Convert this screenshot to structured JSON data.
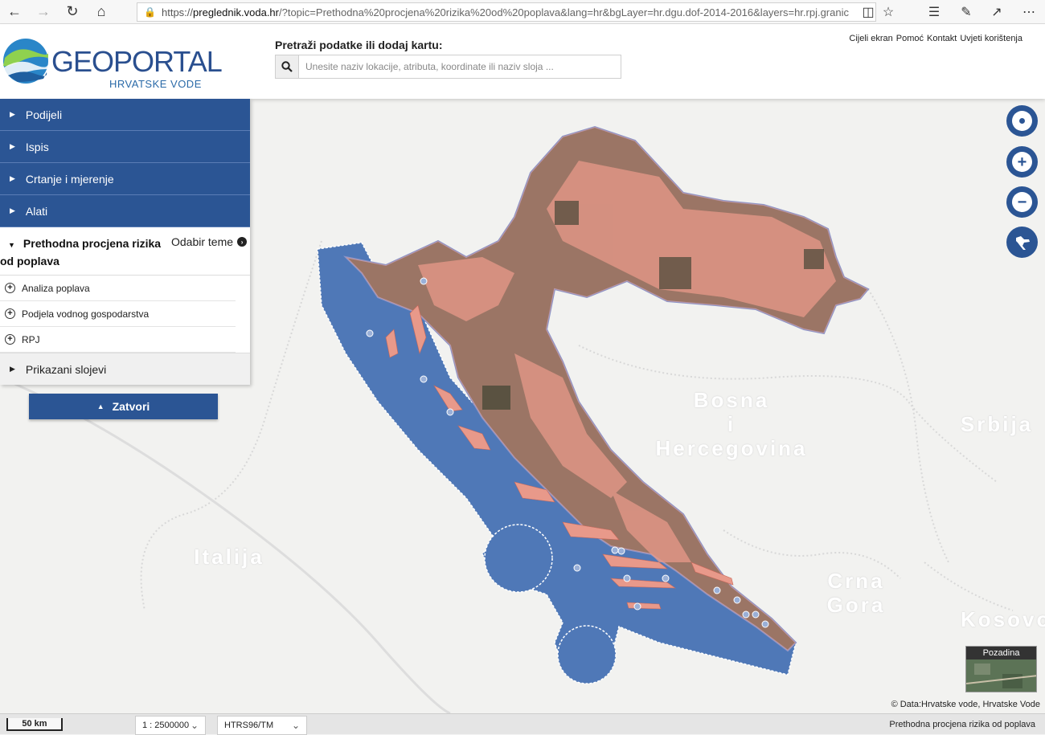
{
  "browser": {
    "url_prefix": "https://",
    "url_domain": "preglednik.voda.hr",
    "url_rest": "/?topic=Prethodna%20procjena%20rizika%20od%20poplava&lang=hr&bgLayer=hr.dgu.dof-2014-2016&layers=hr.rpj.granic"
  },
  "header": {
    "logo_word": "GEOPORTAL",
    "logo_sub": "HRVATSKE VODE",
    "search_label": "Pretraži podatke ili dodaj kartu:",
    "search_placeholder": "Unesite naziv lokacije, atributa, koordinate ili naziv sloja ...",
    "links": [
      "Cijeli ekran",
      "Pomoć",
      "Kontakt",
      "Uvjeti korištenja"
    ]
  },
  "panel": {
    "menu": [
      "Podijeli",
      "Ispis",
      "Crtanje i mjerenje",
      "Alati"
    ],
    "topic_title": "Prethodna procjena rizika od poplava",
    "topic_link": "Odabir teme",
    "layers": [
      "Analiza poplava",
      "Podjela vodnog gospodarstva",
      "RPJ"
    ],
    "shown_layers": "Prikazani slojevi",
    "close_label": "Zatvori"
  },
  "map": {
    "labels": {
      "bosna": "Bosna\ni\nHercegovina",
      "srbija": "Srbija",
      "italija": "Italija",
      "crna_gora": "Crna\nGora",
      "kosovo": "Kosovo"
    },
    "background_label": "Pozadina",
    "attribution_prefix": "© Data:",
    "attribution_links": "Hrvatske vode, Hrvatske Vode"
  },
  "footer": {
    "scale_bar": "50 km",
    "scale": "1 : 2500000",
    "projection": "HTRS96/TM",
    "topic": "Prethodna procjena rizika od poplava"
  },
  "colors": {
    "primary": "#2b5594",
    "sea_area": "#4f78b7",
    "land_overlay": "#e8998a",
    "land_dark": "#3f4a38"
  }
}
